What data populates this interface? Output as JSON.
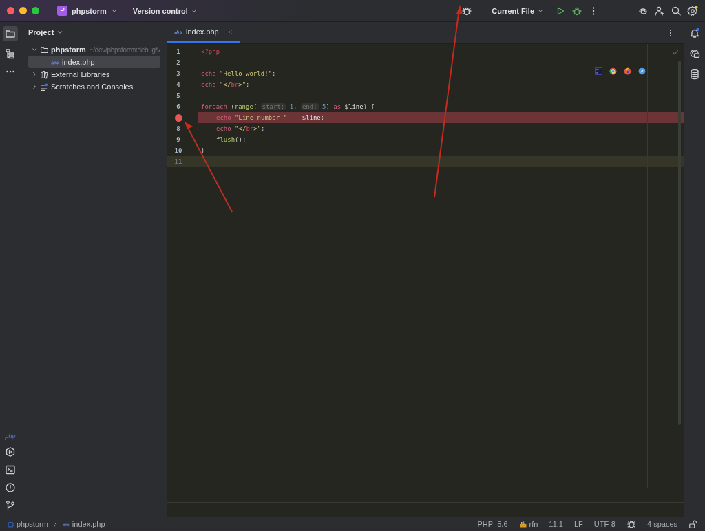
{
  "title_bar": {
    "project": {
      "letter": "P",
      "name": "phpstorm"
    },
    "vcs": "Version control",
    "run_config": "Current File"
  },
  "project_panel": {
    "title": "Project",
    "tree": [
      {
        "name": "phpstorm",
        "kind": "folder",
        "path": "~/dev/phpstormxdebug/v",
        "expanded": true,
        "selected": false,
        "children": [
          {
            "name": "index.php",
            "kind": "php",
            "selected": true
          }
        ]
      },
      {
        "name": "External Libraries",
        "kind": "library",
        "expanded": false,
        "selected": false
      },
      {
        "name": "Scratches and Consoles",
        "kind": "scratch",
        "expanded": false,
        "selected": false
      }
    ]
  },
  "left_toolbar": {
    "php_label": "php"
  },
  "tabs": [
    {
      "label": "index.php",
      "selected": true
    }
  ],
  "editor": {
    "lines": [
      {
        "number": "1",
        "tokens": [
          {
            "kind": "tag",
            "text": "<?php"
          }
        ]
      },
      {
        "number": "2"
      },
      {
        "number": "3",
        "tokens": [
          {
            "kind": "keyword",
            "text": "echo"
          },
          {
            "kind": "string",
            "text": " \"Hello world!\""
          },
          {
            "kind": "plain",
            "text": ";"
          }
        ]
      },
      {
        "number": "4",
        "tokens": [
          {
            "kind": "keyword",
            "text": "echo"
          },
          {
            "kind": "string",
            "text": " \"</"
          },
          {
            "kind": "tag",
            "text": "br"
          },
          {
            "kind": "string",
            "text": ">\""
          },
          {
            "kind": "plain",
            "text": ";"
          }
        ]
      },
      {
        "number": "5"
      },
      {
        "number": "6",
        "tokens": [
          {
            "kind": "keyword",
            "text": "foreach"
          },
          {
            "kind": "plain",
            "text": " ("
          },
          {
            "kind": "function",
            "text": "range"
          },
          {
            "kind": "plain",
            "text": "( "
          },
          {
            "kind": "hint",
            "text": "start:"
          },
          {
            "kind": "number",
            "text": " 1"
          },
          {
            "kind": "plain",
            "text": ", "
          },
          {
            "kind": "hint",
            "text": "end:"
          },
          {
            "kind": "number",
            "text": " 5"
          },
          {
            "kind": "plain",
            "text": ") "
          },
          {
            "kind": "keyword",
            "text": "as"
          },
          {
            "kind": "variable",
            "text": " $line"
          },
          {
            "kind": "plain",
            "text": ") {"
          }
        ]
      },
      {
        "breakpoint": true,
        "indented": true,
        "tokens": [
          {
            "kind": "keyword",
            "text": "echo"
          },
          {
            "kind": "string",
            "text": " \"Line number \""
          },
          {
            "kind": "variable",
            "text": "    $line"
          },
          {
            "kind": "plain",
            "text": ";"
          }
        ]
      },
      {
        "number": "8",
        "indented": true,
        "tokens": [
          {
            "kind": "keyword",
            "text": "echo"
          },
          {
            "kind": "string",
            "text": " \"</"
          },
          {
            "kind": "tag",
            "text": "br"
          },
          {
            "kind": "string",
            "text": ">\""
          },
          {
            "kind": "plain",
            "text": ";"
          }
        ]
      },
      {
        "number": "9",
        "indented": true,
        "tokens": [
          {
            "kind": "function",
            "text": "flush"
          },
          {
            "kind": "plain",
            "text": "();"
          }
        ]
      },
      {
        "number": "10",
        "tokens": [
          {
            "kind": "plain",
            "text": "}"
          }
        ]
      },
      {
        "number": "11",
        "current": true
      }
    ]
  },
  "status_bar": {
    "breadcrumbs": [
      "phpstorm",
      "index.php"
    ],
    "items": [
      "PHP: 5.6",
      "rfn",
      "11:1",
      "LF",
      "UTF-8",
      "4 spaces"
    ]
  }
}
